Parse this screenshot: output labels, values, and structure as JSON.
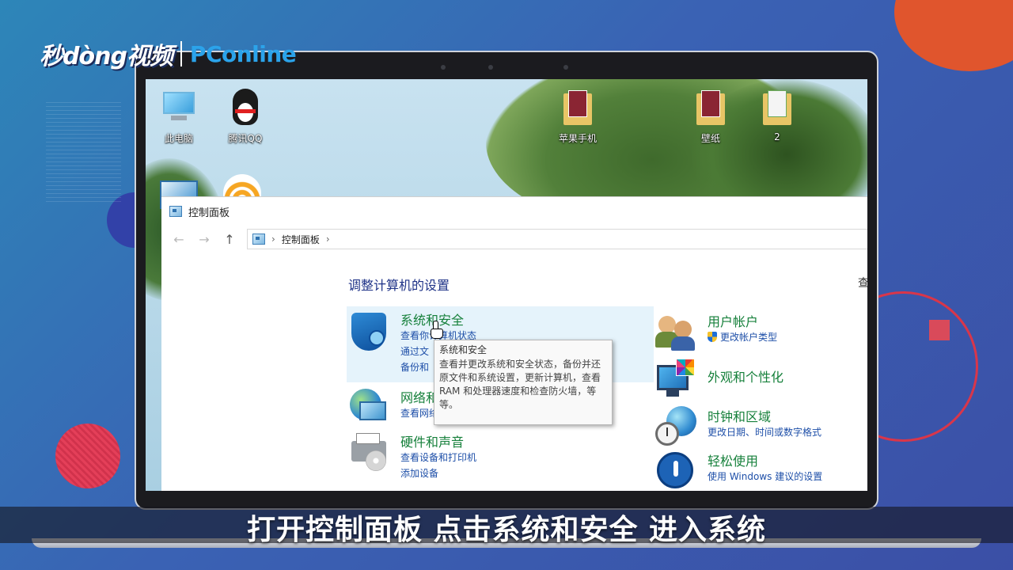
{
  "logo": {
    "left": "秒dòng视频",
    "right": "PConline"
  },
  "desktop": {
    "icons": [
      {
        "label": "此电脑"
      },
      {
        "label": "腾讯QQ"
      },
      {
        "label": "苹果手机"
      },
      {
        "label": "壁纸"
      },
      {
        "label": "2"
      }
    ]
  },
  "window": {
    "title": "控制面板",
    "address": {
      "breadcrumb": "控制面板"
    },
    "heading": "调整计算机的设置",
    "view_by_label": "查"
  },
  "categories_left": [
    {
      "title": "系统和安全",
      "links": [
        "查看你计算机状态",
        "通过文",
        "备份和"
      ],
      "icon": "shield-icon"
    },
    {
      "title": "网络和 Internet",
      "links": [
        "查看网络状态和任务"
      ],
      "icon": "network-icon"
    },
    {
      "title": "硬件和声音",
      "links": [
        "查看设备和打印机",
        "添加设备"
      ],
      "icon": "printer-icon"
    }
  ],
  "categories_right": [
    {
      "title": "用户帐户",
      "links": [
        "更改帐户类型"
      ],
      "icon": "users-icon"
    },
    {
      "title": "外观和个性化",
      "links": [],
      "icon": "appearance-icon"
    },
    {
      "title": "时钟和区域",
      "links": [
        "更改日期、时间或数字格式"
      ],
      "icon": "clock-icon"
    },
    {
      "title": "轻松使用",
      "links": [
        "使用 Windows 建议的设置"
      ],
      "icon": "ease-of-access-icon"
    }
  ],
  "tooltip": {
    "title": "系统和安全",
    "body": "查看并更改系统和安全状态，备份并还原文件和系统设置，更新计算机，查看 RAM 和处理器速度和检查防火墙，等等。"
  },
  "subtitle": "打开控制面板 点击系统和安全 进入系统",
  "colors": {
    "accent_green": "#16803b",
    "link_blue": "#1e4fa8",
    "heading_blue": "#1e3287"
  }
}
